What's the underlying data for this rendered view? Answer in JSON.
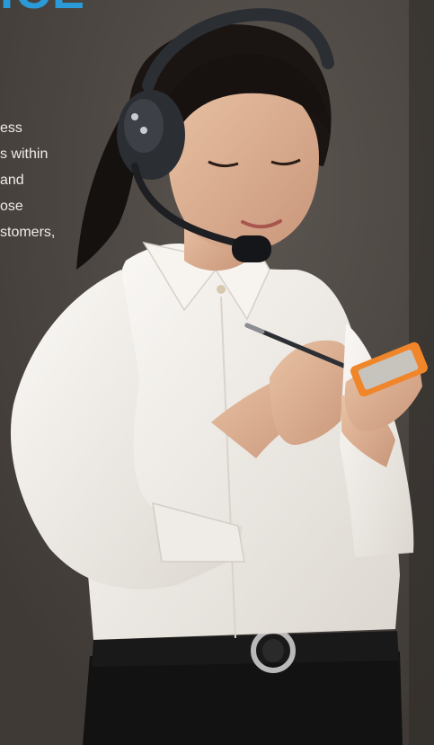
{
  "heading": {
    "text": "ICE",
    "color": "#2a9bd8"
  },
  "body_text": {
    "lines": [
      "ess",
      "s within",
      "and",
      "ose",
      "stomers,"
    ]
  },
  "colors": {
    "background": "#4a4541",
    "text": "#f0ebe4",
    "shirt": "#f2efea",
    "hair": "#15110f",
    "headset": "#2b2e33",
    "phone": "#f0852a",
    "pants": "#121212"
  },
  "icons": [
    "headset-icon",
    "belt-buckle-icon",
    "pen-icon",
    "phone-icon"
  ]
}
